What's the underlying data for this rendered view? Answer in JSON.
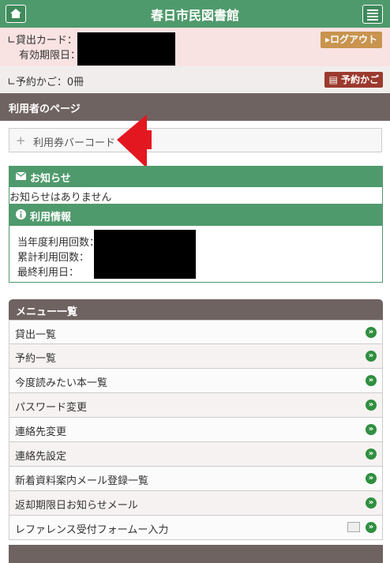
{
  "header": {
    "title": "春日市民図書館"
  },
  "account": {
    "card_label": "∟貸出カード：",
    "expiry_label": "有効期限日：",
    "logout_label": "▸ログアウト",
    "reservation_label": "∟予約かご：0冊",
    "reservation_button": "予約かご"
  },
  "user_page": {
    "title": "利用者のページ",
    "barcode_label": "利用券バーコード"
  },
  "notice": {
    "title": "お知らせ",
    "body": "お知らせはありません"
  },
  "usage": {
    "title": "利用情報",
    "lines": [
      "当年度利用回数：",
      "累計利用回数：",
      "最終利用日："
    ]
  },
  "menu": {
    "title": "メニュー一覧",
    "items": [
      "貸出一覧",
      "予約一覧",
      "今度読みたい本一覧",
      "パスワード変更",
      "連絡先変更",
      "連絡先設定",
      "新着資料案内メール登録一覧",
      "返却期限日お知らせメール",
      "レファレンス受付フォームー入力"
    ]
  },
  "colors": {
    "primary": "#4f9a6c",
    "brown": "#6f6361",
    "logout": "#c8944e",
    "reserve": "#9c3a2e",
    "arrow": "#e3171f"
  }
}
